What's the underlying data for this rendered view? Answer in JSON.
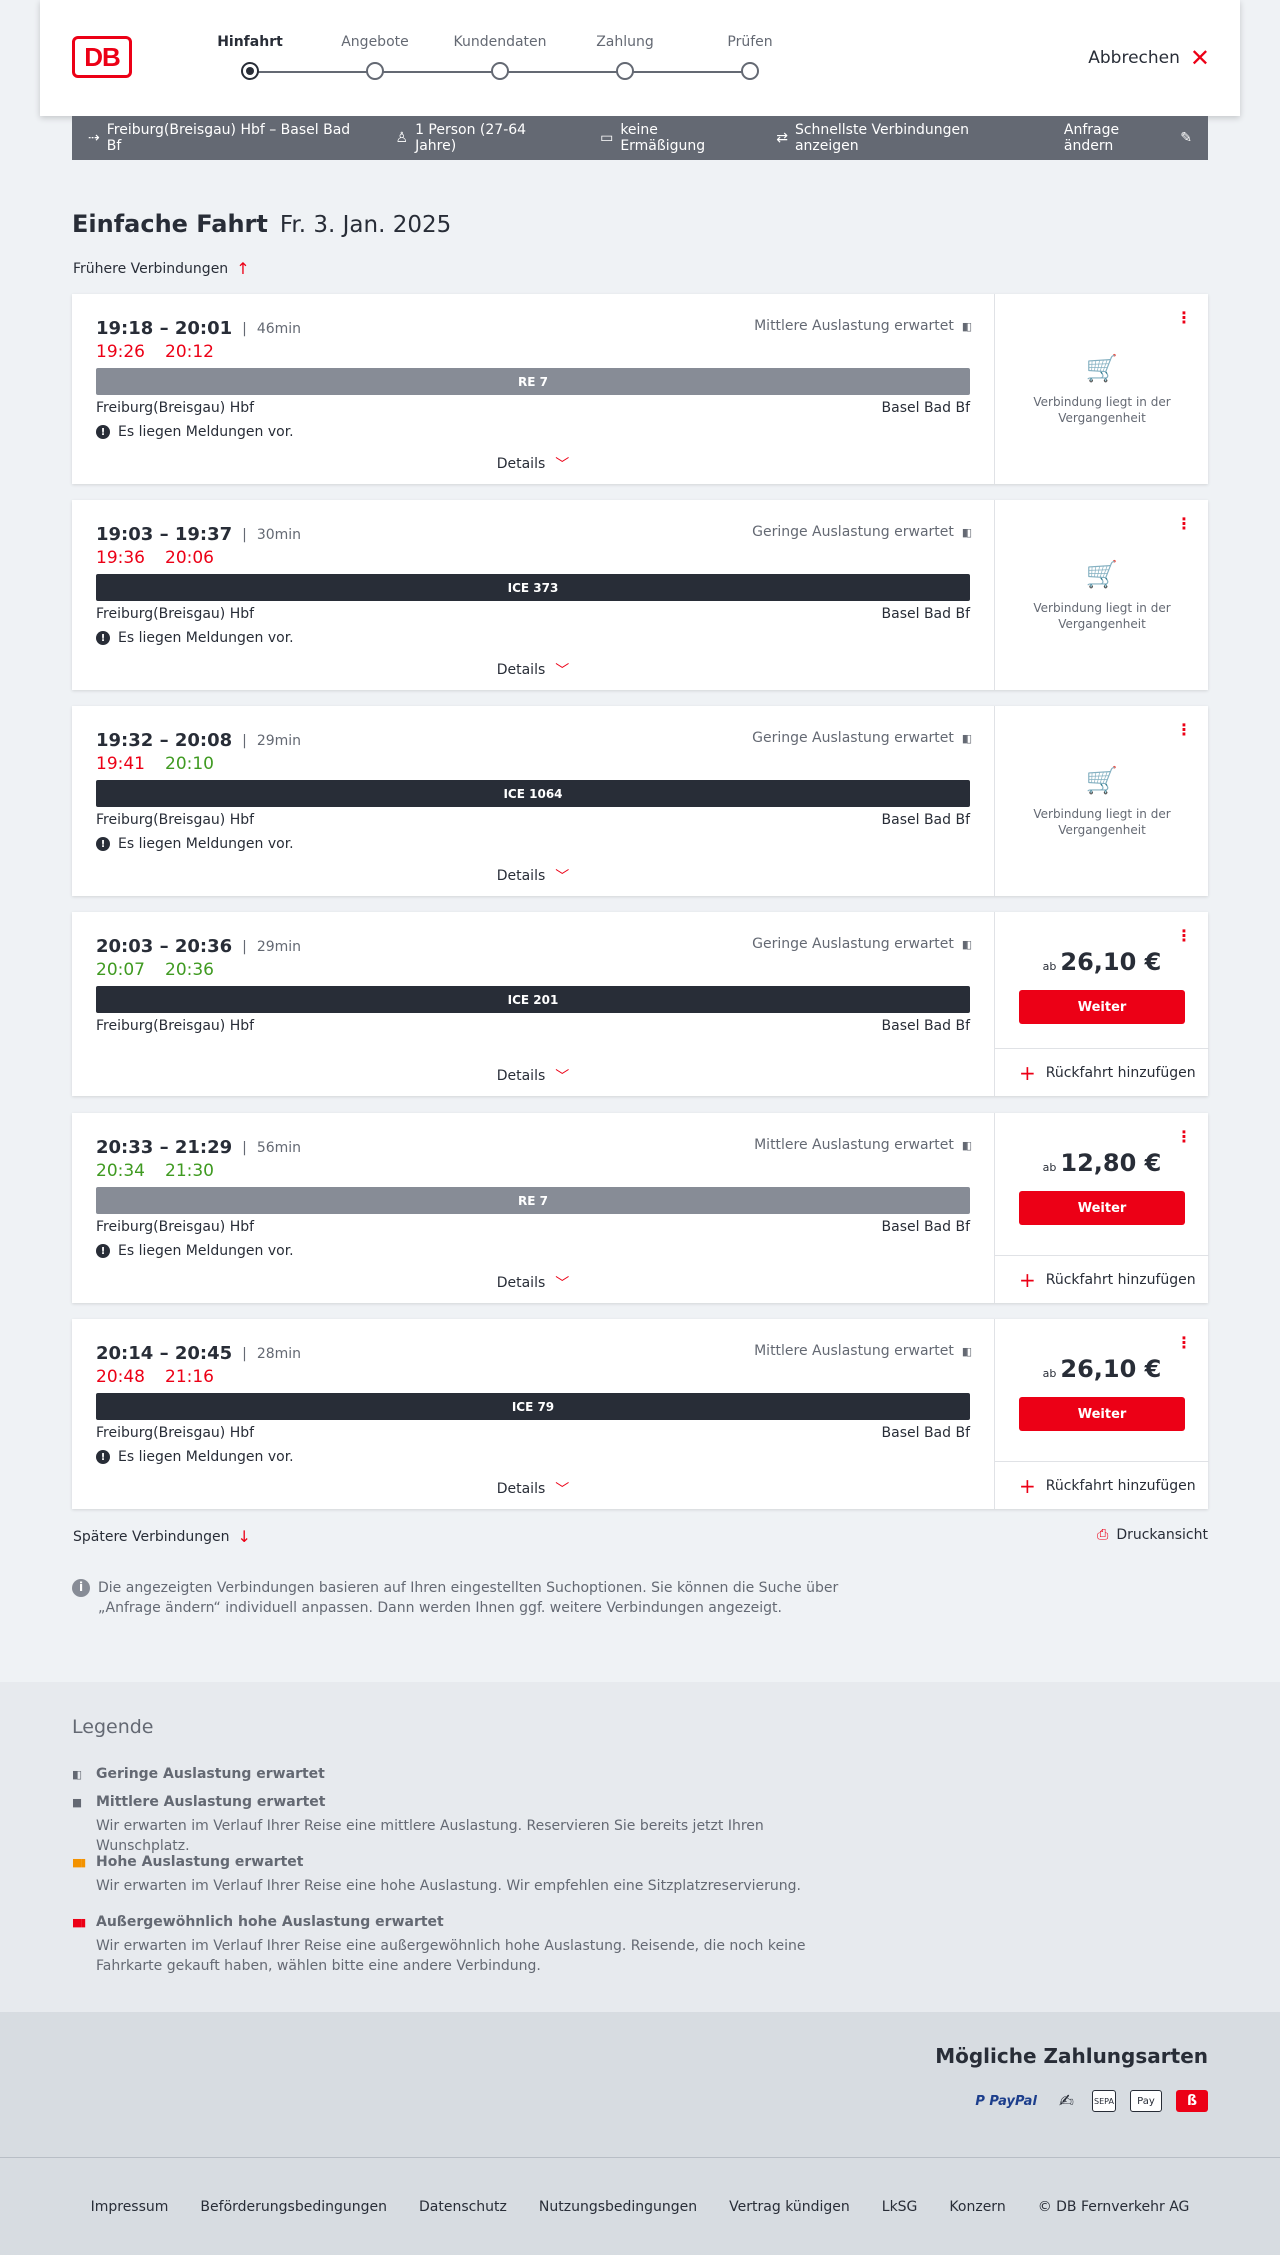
{
  "header": {
    "logo_text": "DB",
    "steps": [
      {
        "label": "Hinfahrt",
        "active": true
      },
      {
        "label": "Angebote",
        "active": false
      },
      {
        "label": "Kundendaten",
        "active": false
      },
      {
        "label": "Zahlung",
        "active": false
      },
      {
        "label": "Prüfen",
        "active": false
      }
    ],
    "cancel_label": "Abbrechen"
  },
  "searchbar": {
    "route": "Freiburg(Breisgau) Hbf – Basel Bad Bf",
    "travellers": "1 Person (27-64 Jahre)",
    "discount": "keine Ermäßigung",
    "fastest": "Schnellste Verbindungen anzeigen",
    "edit": "Anfrage ändern"
  },
  "title": {
    "main": "Einfache Fahrt",
    "date": "Fr. 3. Jan. 2025"
  },
  "earlier": "Frühere Verbindungen",
  "later": "Spätere Verbindungen",
  "print": "Druckansicht",
  "common": {
    "details": "Details",
    "weiter": "Weiter",
    "rueckfahrt": "Rückfahrt hinzufügen",
    "ab": "ab",
    "past": "Verbindung liegt in der Vergangenheit",
    "from": "Freiburg(Breisgau) Hbf",
    "to": "Basel Bad Bf",
    "message": "Es liegen Meldungen vor."
  },
  "connections": [
    {
      "times": "19:18 – 20:01",
      "duration": "46min",
      "rt_dep": "19:26",
      "rt_arr": "20:12",
      "rt_color": "red",
      "occupancy": "Mittlere Auslastung erwartet",
      "train": "RE 7",
      "regional": true,
      "message": true,
      "past": true,
      "price": ""
    },
    {
      "times": "19:03 – 19:37",
      "duration": "30min",
      "rt_dep": "19:36",
      "rt_arr": "20:06",
      "rt_color": "red",
      "occupancy": "Geringe Auslastung erwartet",
      "train": "ICE 373",
      "regional": false,
      "message": true,
      "past": true,
      "price": ""
    },
    {
      "times": "19:32 – 20:08",
      "duration": "29min",
      "rt_dep": "19:41",
      "rt_arr": "20:10",
      "rt_color": "mixed",
      "occupancy": "Geringe Auslastung erwartet",
      "train": "ICE 1064",
      "regional": false,
      "message": true,
      "past": true,
      "price": ""
    },
    {
      "times": "20:03 – 20:36",
      "duration": "29min",
      "rt_dep": "20:07",
      "rt_arr": "20:36",
      "rt_color": "green",
      "occupancy": "Geringe Auslastung erwartet",
      "train": "ICE 201",
      "regional": false,
      "message": false,
      "past": false,
      "price": "26,10 €"
    },
    {
      "times": "20:33 – 21:29",
      "duration": "56min",
      "rt_dep": "20:34",
      "rt_arr": "21:30",
      "rt_color": "green",
      "occupancy": "Mittlere Auslastung erwartet",
      "train": "RE 7",
      "regional": true,
      "message": true,
      "past": false,
      "price": "12,80 €"
    },
    {
      "times": "20:14 – 20:45",
      "duration": "28min",
      "rt_dep": "20:48",
      "rt_arr": "21:16",
      "rt_color": "red",
      "occupancy": "Mittlere Auslastung erwartet",
      "train": "ICE 79",
      "regional": false,
      "message": true,
      "past": false,
      "price": "26,10 €"
    }
  ],
  "info_text": "Die angezeigten Verbindungen basieren auf Ihren eingestellten Suchoptionen. Sie können die Suche über „Anfrage ändern“ individuell anpassen. Dann werden Ihnen ggf. weitere Verbindungen angezeigt.",
  "legend": {
    "title": "Legende",
    "items": [
      {
        "title": "Geringe Auslastung erwartet",
        "desc": "",
        "color": "#646973"
      },
      {
        "title": "Mittlere Auslastung erwartet",
        "desc": "Wir erwarten im Verlauf Ihrer Reise eine mittlere Auslastung. Reservieren Sie bereits jetzt Ihren Wunschplatz.",
        "color": "#646973"
      },
      {
        "title": "Hohe Auslastung erwartet",
        "desc": "Wir erwarten im Verlauf Ihrer Reise eine hohe Auslastung. Wir empfehlen eine Sitzplatzreservierung.",
        "color": "#f39200"
      },
      {
        "title": "Außergewöhnlich hohe Auslastung erwartet",
        "desc": "Wir erwarten im Verlauf Ihrer Reise eine außergewöhnlich hohe Auslastung. Reisende, die noch keine Fahrkarte gekauft haben, wählen bitte eine andere Verbindung.",
        "color": "#ec0016"
      }
    ]
  },
  "payment": {
    "title": "Mögliche Zahlungsarten",
    "methods": [
      {
        "name": "paypal",
        "label": "P PayPal"
      },
      {
        "name": "hand",
        "label": "✍"
      },
      {
        "name": "sepa",
        "label": "SEPA"
      },
      {
        "name": "apple",
        "label": " Pay"
      },
      {
        "name": "db",
        "label": "ß"
      }
    ]
  },
  "footer": {
    "links": [
      "Impressum",
      "Beförderungsbedingungen",
      "Datenschutz",
      "Nutzungsbedingungen",
      "Vertrag kündigen",
      "LkSG",
      "Konzern",
      "© DB Fernverkehr AG"
    ]
  }
}
